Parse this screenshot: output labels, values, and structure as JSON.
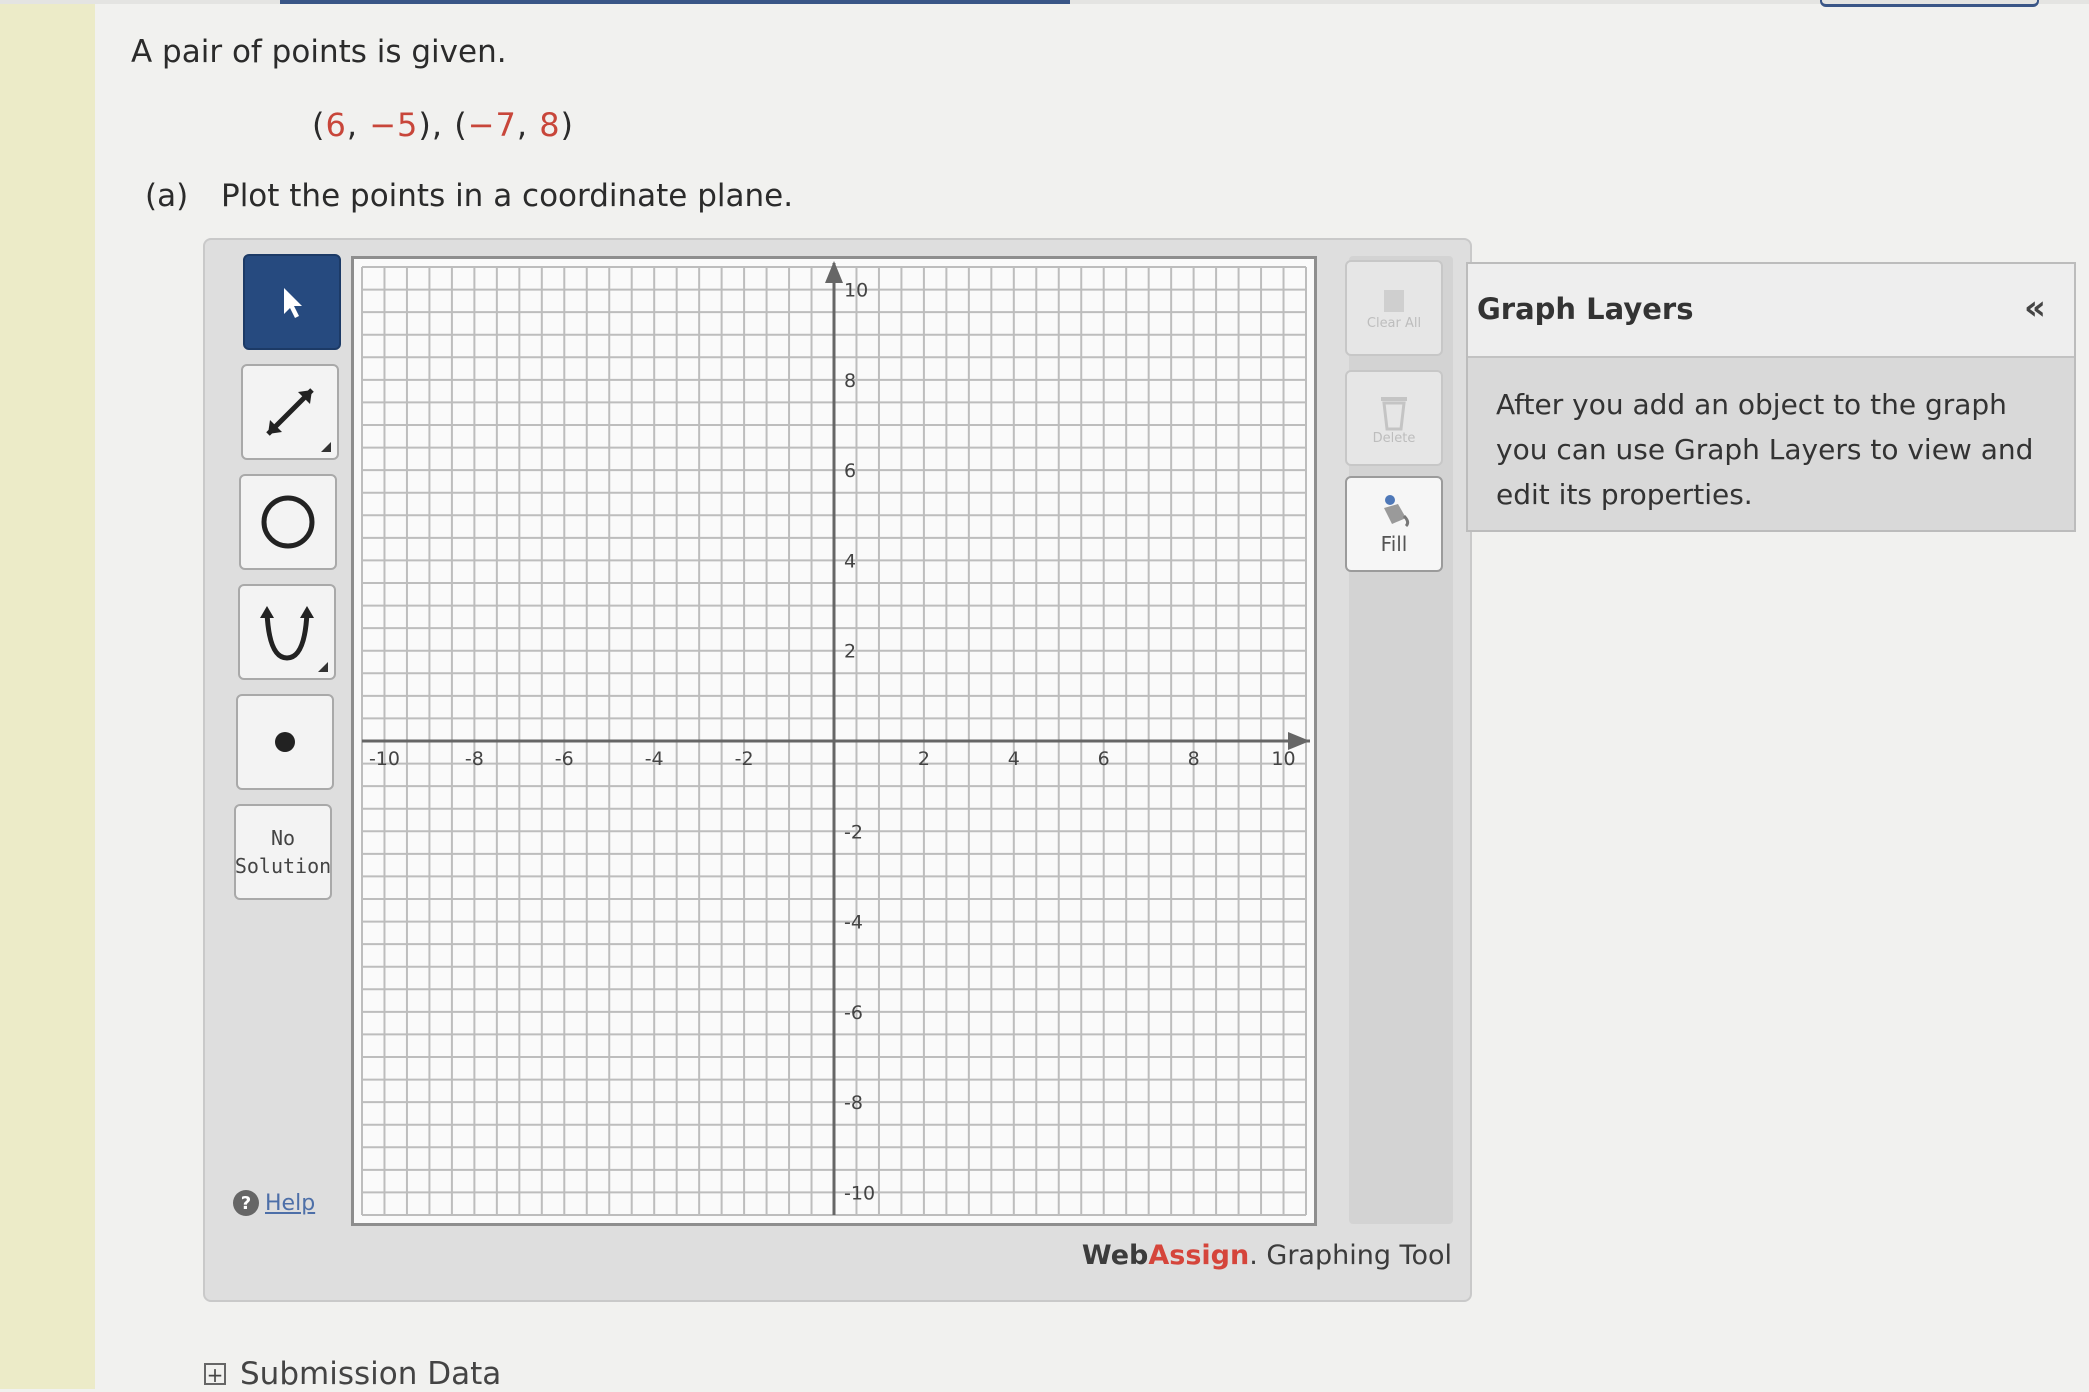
{
  "question": {
    "prompt": "A pair of points is given.",
    "point_open": "(",
    "p1_x": "6",
    "comma1": ", ",
    "p1_y": "−5",
    "mid": "), (",
    "p2_x": "−7",
    "comma2": ", ",
    "p2_y": "8",
    "point_close": ")",
    "part_label": "(a)",
    "part_text": "Plot the points in a coordinate plane."
  },
  "toolbar": {
    "tools": [
      "pointer-tool",
      "line-tool",
      "circle-tool",
      "parabola-tool",
      "point-tool"
    ],
    "no_solution_line1": "No",
    "no_solution_line2": "Solution",
    "help_label": "Help"
  },
  "side_tools": {
    "clear_all_label": "Clear All",
    "delete_label": "Delete",
    "fill_label": "Fill"
  },
  "graph": {
    "x_min": -10,
    "x_max": 10,
    "y_min": -10,
    "y_max": 10,
    "grid_step": 1,
    "tick_step": 2,
    "x_tick_labels": [
      "-10",
      "-8",
      "-6",
      "-4",
      "-2",
      "2",
      "4",
      "6",
      "8",
      "10"
    ],
    "y_tick_labels": [
      "10",
      "8",
      "6",
      "4",
      "2",
      "-2",
      "-4",
      "-6",
      "-8",
      "-10"
    ]
  },
  "branding": {
    "web": "Web",
    "assign": "Assign",
    "suffix": ". Graphing Tool"
  },
  "layers": {
    "title": "Graph Layers",
    "collapse_icon": "«",
    "body": "After you add an object to the graph you can use Graph Layers to view and edit its properties."
  },
  "submission": {
    "label": "Submission Data"
  }
}
